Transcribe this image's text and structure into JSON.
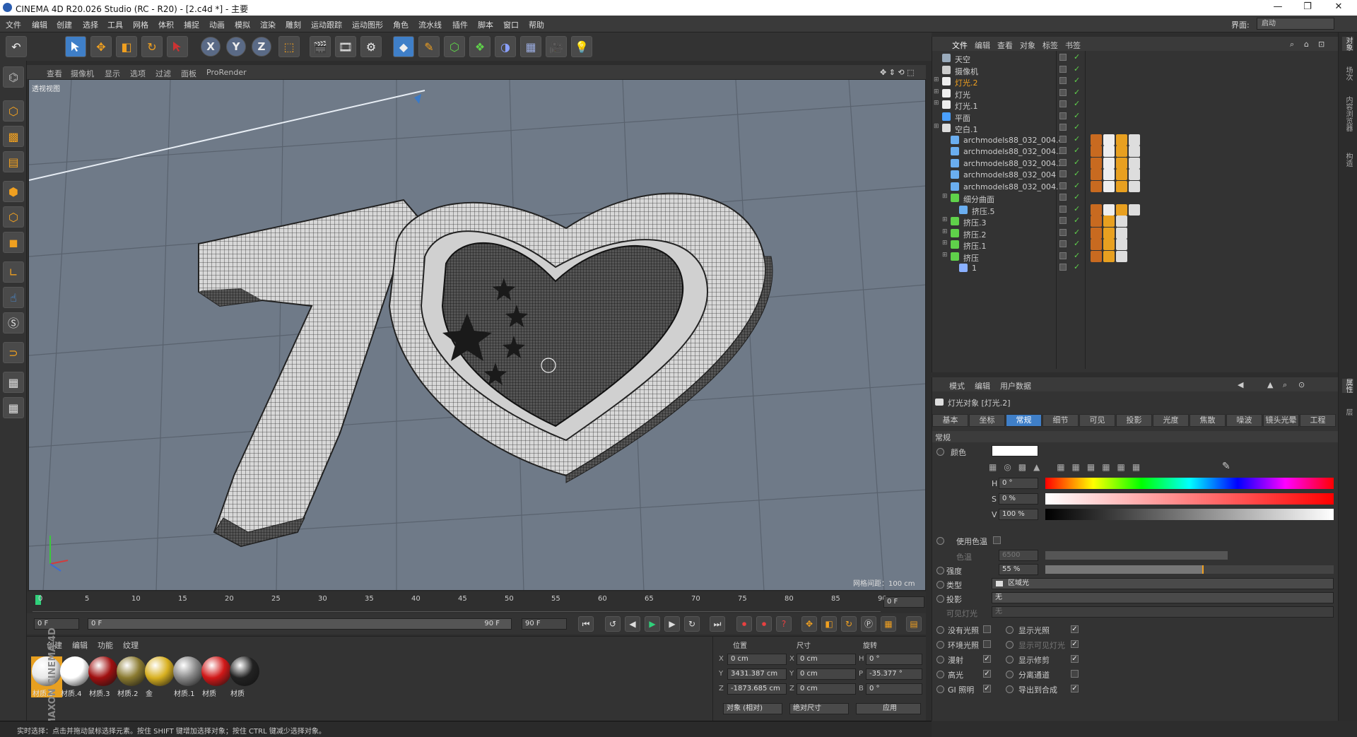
{
  "window": {
    "title": "CINEMA 4D R20.026 Studio (RC - R20) - [2.c4d *] - 主要",
    "min": "—",
    "max": "❐",
    "close": "✕"
  },
  "menu": {
    "items": [
      "文件",
      "编辑",
      "创建",
      "选择",
      "工具",
      "网格",
      "体积",
      "捕捉",
      "动画",
      "模拟",
      "渲染",
      "雕刻",
      "运动跟踪",
      "运动图形",
      "角色",
      "流水线",
      "插件",
      "脚本",
      "窗口",
      "帮助"
    ],
    "interface_label": "界面:",
    "interface_value": "启动"
  },
  "toolbar": {
    "undo": "↶",
    "axes": [
      "X",
      "Y",
      "Z"
    ]
  },
  "viewport": {
    "menu": [
      "查看",
      "摄像机",
      "显示",
      "选项",
      "过滤",
      "面板",
      "ProRender"
    ],
    "camera_label": "透视视图",
    "grid_spacing": "网格间距：100 cm"
  },
  "timeline": {
    "ticks": [
      "0",
      "5",
      "10",
      "15",
      "20",
      "25",
      "30",
      "35",
      "40",
      "45",
      "50",
      "55",
      "60",
      "65",
      "70",
      "75",
      "80",
      "85",
      "90"
    ],
    "current_frame": "0 F",
    "start_frame": "0 F",
    "range_start": "0 F",
    "range_end": "90 F",
    "end_frame": "90 F"
  },
  "materials": {
    "menu": [
      "创建",
      "编辑",
      "功能",
      "纹理"
    ],
    "items": [
      {
        "name": "材质.5",
        "color": "#e8e8e8",
        "selected": true
      },
      {
        "name": "材质.4",
        "color": "#ffffff",
        "selected": false
      },
      {
        "name": "材质.3",
        "color": "#a01010",
        "selected": false
      },
      {
        "name": "材质.2",
        "color": "#8a7a30",
        "selected": false
      },
      {
        "name": "金",
        "color": "#d8b020",
        "selected": false
      },
      {
        "name": "材质.1",
        "color": "#888888",
        "selected": false
      },
      {
        "name": "材质",
        "color": "#d01818",
        "selected": false
      },
      {
        "name": "材质",
        "color": "#222222",
        "selected": false
      }
    ]
  },
  "coords": {
    "headers": [
      "位置",
      "尺寸",
      "旋转"
    ],
    "rows": [
      {
        "axis": "X",
        "pos": "0 cm",
        "size": "0 cm",
        "rot_axis": "H",
        "rot": "0 °"
      },
      {
        "axis": "Y",
        "pos": "3431.387 cm",
        "size": "0 cm",
        "rot_axis": "P",
        "rot": "-35.377 °"
      },
      {
        "axis": "Z",
        "pos": "-1873.685 cm",
        "size": "0 cm",
        "rot_axis": "B",
        "rot": "0 °"
      }
    ],
    "mode": "对象 (相对)",
    "size_mode": "绝对尺寸",
    "apply": "应用"
  },
  "status": "实时选择：点击并拖动鼠标选择元素。按住 SHIFT 键增加选择对象；按住 CTRL 键减少选择对象。",
  "branding": "MAXON CINEMA 4D",
  "objects": {
    "menu": [
      "文件",
      "编辑",
      "查看",
      "对象",
      "标签",
      "书签"
    ],
    "rows": [
      {
        "name": "天空",
        "indent": 0,
        "type": "sky",
        "highlight": false
      },
      {
        "name": "摄像机",
        "indent": 0,
        "type": "camera",
        "highlight": false
      },
      {
        "name": "灯光.2",
        "indent": 0,
        "type": "light",
        "highlight": true
      },
      {
        "name": "灯光",
        "indent": 0,
        "type": "light",
        "highlight": false
      },
      {
        "name": "灯光.1",
        "indent": 0,
        "type": "light",
        "highlight": false
      },
      {
        "name": "平面",
        "indent": 0,
        "type": "plane",
        "highlight": false
      },
      {
        "name": "空白.1",
        "indent": 0,
        "type": "null",
        "highlight": false
      },
      {
        "name": "archmodels88_032_004.4",
        "indent": 1,
        "type": "mesh",
        "highlight": false
      },
      {
        "name": "archmodels88_032_004.3",
        "indent": 1,
        "type": "mesh",
        "highlight": false
      },
      {
        "name": "archmodels88_032_004.2",
        "indent": 1,
        "type": "mesh",
        "highlight": false
      },
      {
        "name": "archmodels88_032_004",
        "indent": 1,
        "type": "mesh",
        "highlight": false
      },
      {
        "name": "archmodels88_032_004.1",
        "indent": 1,
        "type": "mesh",
        "highlight": false
      },
      {
        "name": "细分曲面",
        "indent": 1,
        "type": "subd",
        "highlight": false
      },
      {
        "name": "挤压.5",
        "indent": 2,
        "type": "mesh",
        "highlight": false
      },
      {
        "name": "挤压.3",
        "indent": 1,
        "type": "extrude",
        "highlight": false
      },
      {
        "name": "挤压.2",
        "indent": 1,
        "type": "extrude",
        "highlight": false
      },
      {
        "name": "挤压.1",
        "indent": 1,
        "type": "extrude",
        "highlight": false
      },
      {
        "name": "挤压",
        "indent": 1,
        "type": "extrude",
        "highlight": false
      },
      {
        "name": "1",
        "indent": 2,
        "type": "spline",
        "highlight": false
      }
    ]
  },
  "attributes": {
    "menu": [
      "模式",
      "编辑",
      "用户数据"
    ],
    "object_title": "灯光对象 [灯光.2]",
    "tabs": [
      "基本",
      "坐标",
      "常规",
      "细节",
      "可见",
      "投影",
      "光度",
      "焦散",
      "噪波",
      "镜头光晕",
      "工程"
    ],
    "active_tab": "常规",
    "section": "常规",
    "color_label": "颜色",
    "color_value": "#ffffff",
    "h_label": "H",
    "h_value": "0 °",
    "s_label": "S",
    "s_value": "0 %",
    "v_label": "V",
    "v_value": "100 %",
    "use_temp_label": "使用色温",
    "temp_label": "色温",
    "temp_value": "6500",
    "intensity_label": "强度",
    "intensity_value": "55 %",
    "intensity_fraction": 0.55,
    "type_label": "类型",
    "type_value": "区域光",
    "shadow_label": "投影",
    "shadow_value": "无",
    "visible_label": "可见灯光",
    "visible_value": "无",
    "left_checks": [
      {
        "label": "没有光照",
        "checked": false
      },
      {
        "label": "环境光照",
        "checked": false
      },
      {
        "label": "漫射",
        "checked": true
      },
      {
        "label": "高光",
        "checked": true
      },
      {
        "label": "GI 照明",
        "checked": true
      }
    ],
    "right_checks": [
      {
        "label": "显示光照",
        "checked": true
      },
      {
        "label": "显示可见灯光",
        "checked": true
      },
      {
        "label": "显示修剪",
        "checked": true
      },
      {
        "label": "分离通道",
        "checked": false
      },
      {
        "label": "导出到合成",
        "checked": true
      }
    ]
  },
  "right_strip": [
    "对象",
    "场次",
    "内容浏览器",
    "构造",
    "属性",
    "层"
  ]
}
